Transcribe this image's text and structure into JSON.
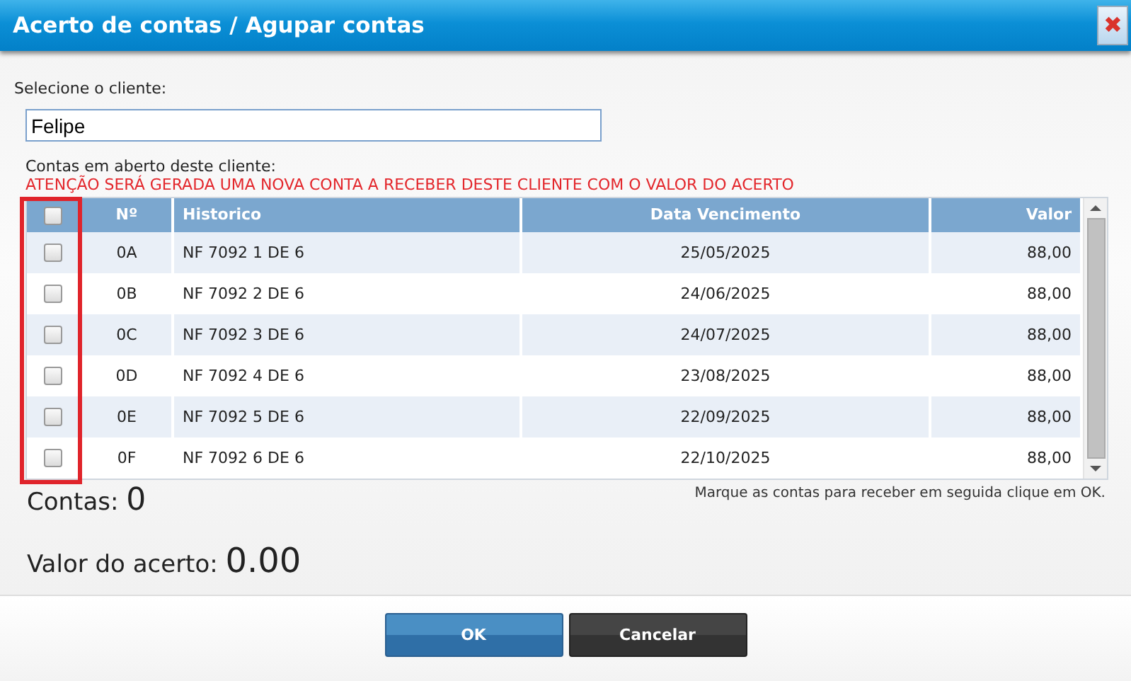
{
  "window": {
    "title": "Acerto de contas / Agupar contas",
    "close": "✖"
  },
  "client": {
    "label": "Selecione o cliente:",
    "value": "Felipe"
  },
  "open_label": "Contas em aberto deste cliente:",
  "warning": "ATENÇÃO SERÁ GERADA UMA NOVA CONTA A RECEBER DESTE CLIENTE COM O VALOR DO ACERTO",
  "table": {
    "select_all": {
      "checked": false
    },
    "highlighted_column": true,
    "columns": [
      "Nº",
      "Historico",
      "Data Vencimento",
      "Valor"
    ],
    "rows": [
      {
        "checked": false,
        "cells": [
          "0A",
          "NF 7092 1 DE 6",
          "25/05/2025",
          "88,00"
        ]
      },
      {
        "checked": false,
        "cells": [
          "0B",
          "NF 7092 2 DE 6",
          "24/06/2025",
          "88,00"
        ]
      },
      {
        "checked": false,
        "cells": [
          "0C",
          "NF 7092 3 DE 6",
          "24/07/2025",
          "88,00"
        ]
      },
      {
        "checked": false,
        "cells": [
          "0D",
          "NF 7092 4 DE 6",
          "23/08/2025",
          "88,00"
        ]
      },
      {
        "checked": false,
        "cells": [
          "0E",
          "NF 7092 5 DE 6",
          "22/09/2025",
          "88,00"
        ]
      },
      {
        "checked": false,
        "cells": [
          "0F",
          "NF 7092 6 DE 6",
          "22/10/2025",
          "88,00"
        ]
      }
    ]
  },
  "count": {
    "label": "Contas:",
    "value": "0"
  },
  "hint": "Marque as contas para receber em seguida clique em OK.",
  "total": {
    "label": "Valor do acerto:",
    "value": "0.00"
  },
  "buttons": [
    {
      "label": "OK",
      "kind": "primary"
    },
    {
      "label": "Cancelar",
      "kind": "secondary"
    }
  ]
}
